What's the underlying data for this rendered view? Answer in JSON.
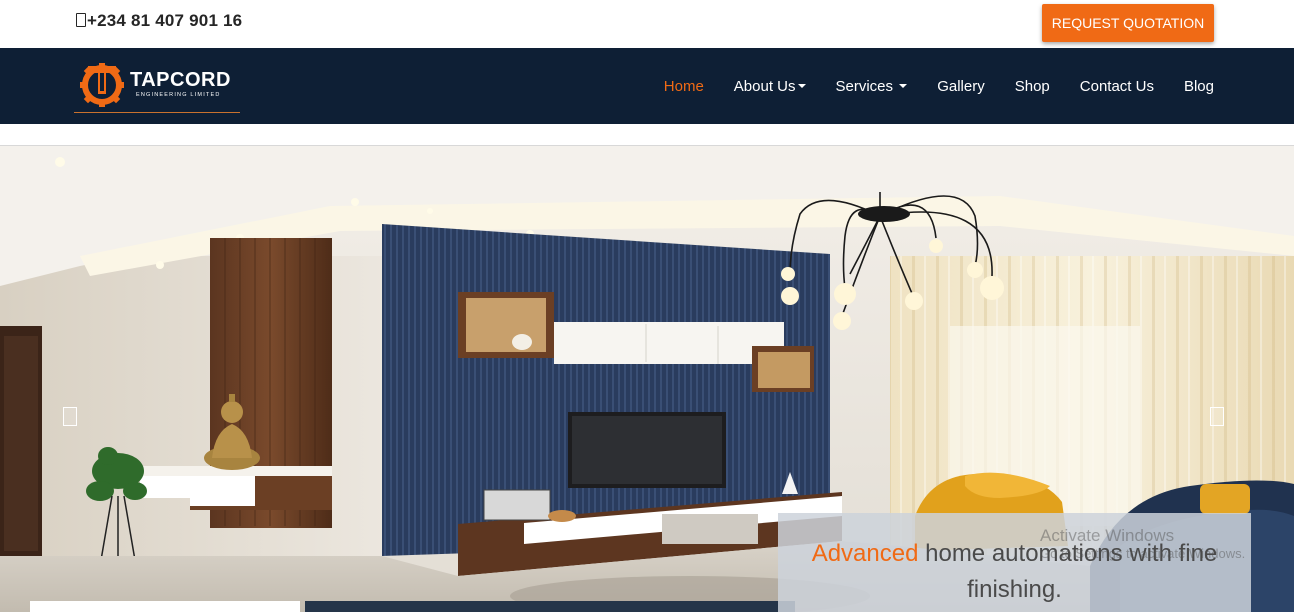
{
  "topbar": {
    "phone_icon": "phone-icon",
    "phone": "+234 81 407 901 16",
    "quote_button": "REQUEST QUOTATION"
  },
  "brand": {
    "name": "TAPCORD",
    "subtitle": "ENGINEERING LIMITED",
    "accent": "#f06a15",
    "navy": "#0e1f35"
  },
  "nav": {
    "items": [
      {
        "label": "Home",
        "active": true
      },
      {
        "label": "About Us",
        "dropdown": true
      },
      {
        "label": "Services",
        "dropdown": true
      },
      {
        "label": "Gallery"
      },
      {
        "label": "Shop"
      },
      {
        "label": "Contact Us"
      },
      {
        "label": "Blog"
      }
    ]
  },
  "hero": {
    "caption_highlight": "Advanced",
    "caption_rest": " home automations with fine finishing.",
    "prev_icon": "chevron-left-icon",
    "next_icon": "chevron-right-icon"
  },
  "watermark": {
    "line1": "Activate Windows",
    "line2": "Go to Settings to activate Windows."
  }
}
